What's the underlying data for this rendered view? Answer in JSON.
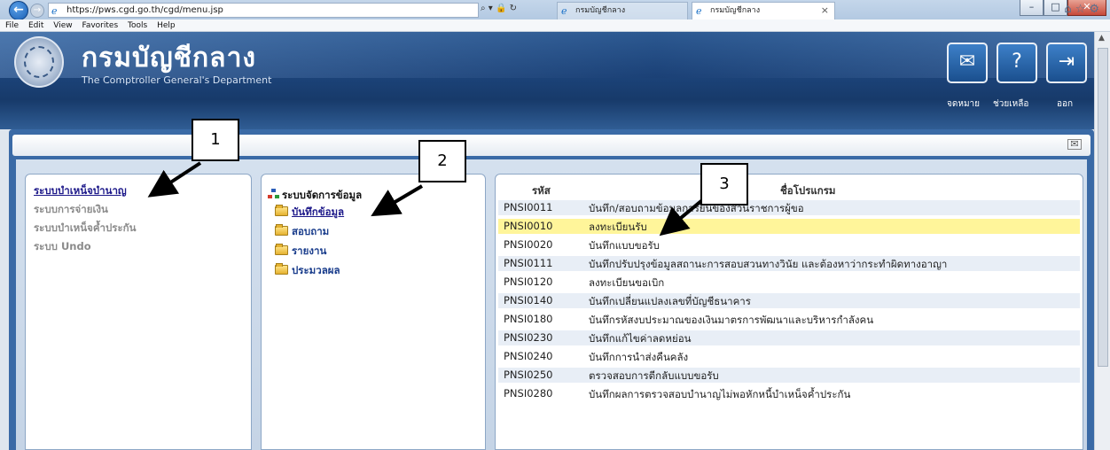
{
  "browser": {
    "url": "https://pws.cgd.go.th/cgd/menu.jsp",
    "tabs": [
      {
        "title": "กรมบัญชีกลาง"
      },
      {
        "title": "กรมบัญชีกลาง"
      }
    ],
    "menu": [
      "File",
      "Edit",
      "View",
      "Favorites",
      "Tools",
      "Help"
    ]
  },
  "header": {
    "title": "กรมบัญชีกลาง",
    "subtitle": "The Comptroller General's Department",
    "buttons": [
      {
        "label": "จดหมาย",
        "icon": "mail-icon"
      },
      {
        "label": "ช่วยเหลือ",
        "icon": "help-icon"
      },
      {
        "label": "ออก",
        "icon": "exit-icon"
      }
    ]
  },
  "systems": [
    {
      "label": "ระบบบำเหน็จบำนาญ",
      "active": true
    },
    {
      "label": "ระบบการจ่ายเงิน",
      "active": false
    },
    {
      "label": "ระบบบำเหน็จค้ำประกัน",
      "active": false
    },
    {
      "label": "ระบบ Undo",
      "active": false
    }
  ],
  "tree": {
    "root": "ระบบจัดการข้อมูล",
    "items": [
      {
        "label": "บันทึกข้อมูล",
        "active": true
      },
      {
        "label": "สอบถาม",
        "active": false
      },
      {
        "label": "รายงาน",
        "active": false
      },
      {
        "label": "ประมวลผล",
        "active": false
      }
    ]
  },
  "programs": {
    "col_code": "รหัส",
    "col_name": "ชื่อโปรแกรม",
    "rows": [
      {
        "code": "PNSI0011",
        "name": "บันทึก/สอบถามข้อมูลการยื่นของส่วนราชการผู้ขอ"
      },
      {
        "code": "PNSI0010",
        "name": "ลงทะเบียนรับ"
      },
      {
        "code": "PNSI0020",
        "name": "บันทึกแบบขอรับ"
      },
      {
        "code": "PNSI0111",
        "name": "บันทึกปรับปรุงข้อมูลสถานะการสอบสวนทางวินัย และต้องหาว่ากระทำผิดทางอาญา"
      },
      {
        "code": "PNSI0120",
        "name": "ลงทะเบียนขอเบิก"
      },
      {
        "code": "PNSI0140",
        "name": "บันทึกเปลี่ยนแปลงเลขที่บัญชีธนาคาร"
      },
      {
        "code": "PNSI0180",
        "name": "บันทึกรหัสงบประมาณของเงินมาตรการพัฒนาและบริหารกำลังคน"
      },
      {
        "code": "PNSI0230",
        "name": "บันทึกแก้ไขค่าลดหย่อน"
      },
      {
        "code": "PNSI0240",
        "name": "บันทึกการนำส่งคืนคลัง"
      },
      {
        "code": "PNSI0250",
        "name": "ตรวจสอบการตีกลับแบบขอรับ"
      },
      {
        "code": "PNSI0280",
        "name": "บันทึกผลการตรวจสอบบำนาญไม่พอหักหนี้บำเหน็จค้ำประกัน"
      }
    ]
  },
  "callouts": [
    "1",
    "2",
    "3"
  ]
}
